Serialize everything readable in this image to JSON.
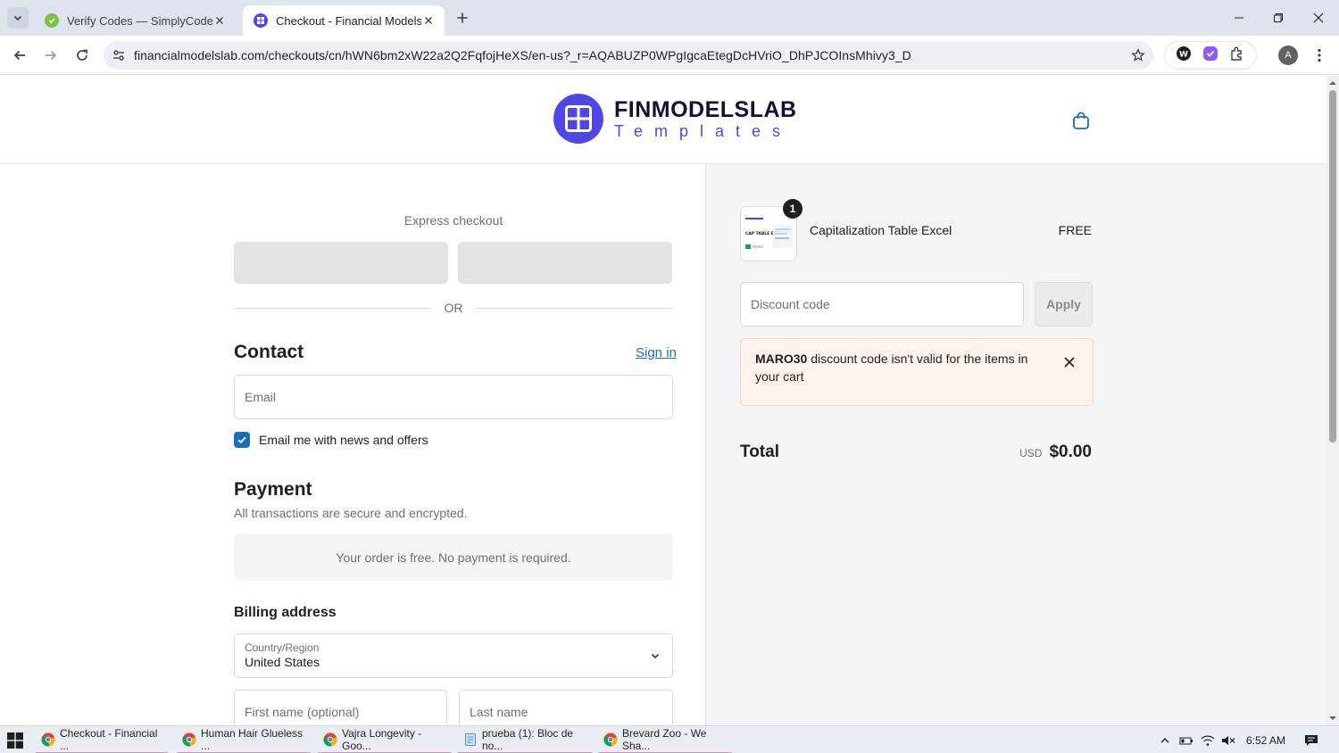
{
  "browser": {
    "tabs": [
      {
        "title": "Verify Codes — SimplyCodes",
        "active": false
      },
      {
        "title": "Checkout - Financial Models Lab",
        "active": true
      }
    ],
    "url": "financialmodelslab.com/checkouts/cn/hWN6bm2xW22a2Q2FqfojHeXS/en-us?_r=AQABUZP0WPgIgcaEtegDcHVriO_DhPJCOInsMhivy3_D",
    "profile_initial": "A"
  },
  "header": {
    "logo_name": "FINMODELSLAB",
    "logo_sub": "Templates"
  },
  "checkout": {
    "express_title": "Express checkout",
    "or_label": "OR",
    "contact_title": "Contact",
    "sign_in": "Sign in",
    "email_placeholder": "Email",
    "newsletter_label": "Email me with news and offers",
    "newsletter_checked": true,
    "payment_title": "Payment",
    "payment_note": "All transactions are secure and encrypted.",
    "free_note": "Your order is free. No payment is required.",
    "billing_title": "Billing address",
    "country_label": "Country/Region",
    "country_value": "United States",
    "first_name_placeholder": "First name (optional)",
    "last_name_placeholder": "Last name"
  },
  "summary": {
    "product_name": "Capitalization Table Excel",
    "product_price": "FREE",
    "quantity": "1",
    "thumb_caption": "CAP TABLE EXCEL",
    "discount_placeholder": "Discount code",
    "apply_label": "Apply",
    "alert_code": "MARO30",
    "alert_text": " discount code isn't valid for the items in your cart",
    "total_label": "Total",
    "total_currency": "USD",
    "total_value": "$0.00"
  },
  "taskbar": {
    "items": [
      "Checkout - Financial ...",
      "Human Hair Glueless ...",
      "Vajra Longevity - Goo...",
      "prueba (1): Bloc de no...",
      "Brevard Zoo - We Sha..."
    ],
    "time": "6:52 AM"
  },
  "colors": {
    "brand": "#4f46e5",
    "link": "#1a6dbb",
    "alert_bg": "#fff4ec"
  }
}
